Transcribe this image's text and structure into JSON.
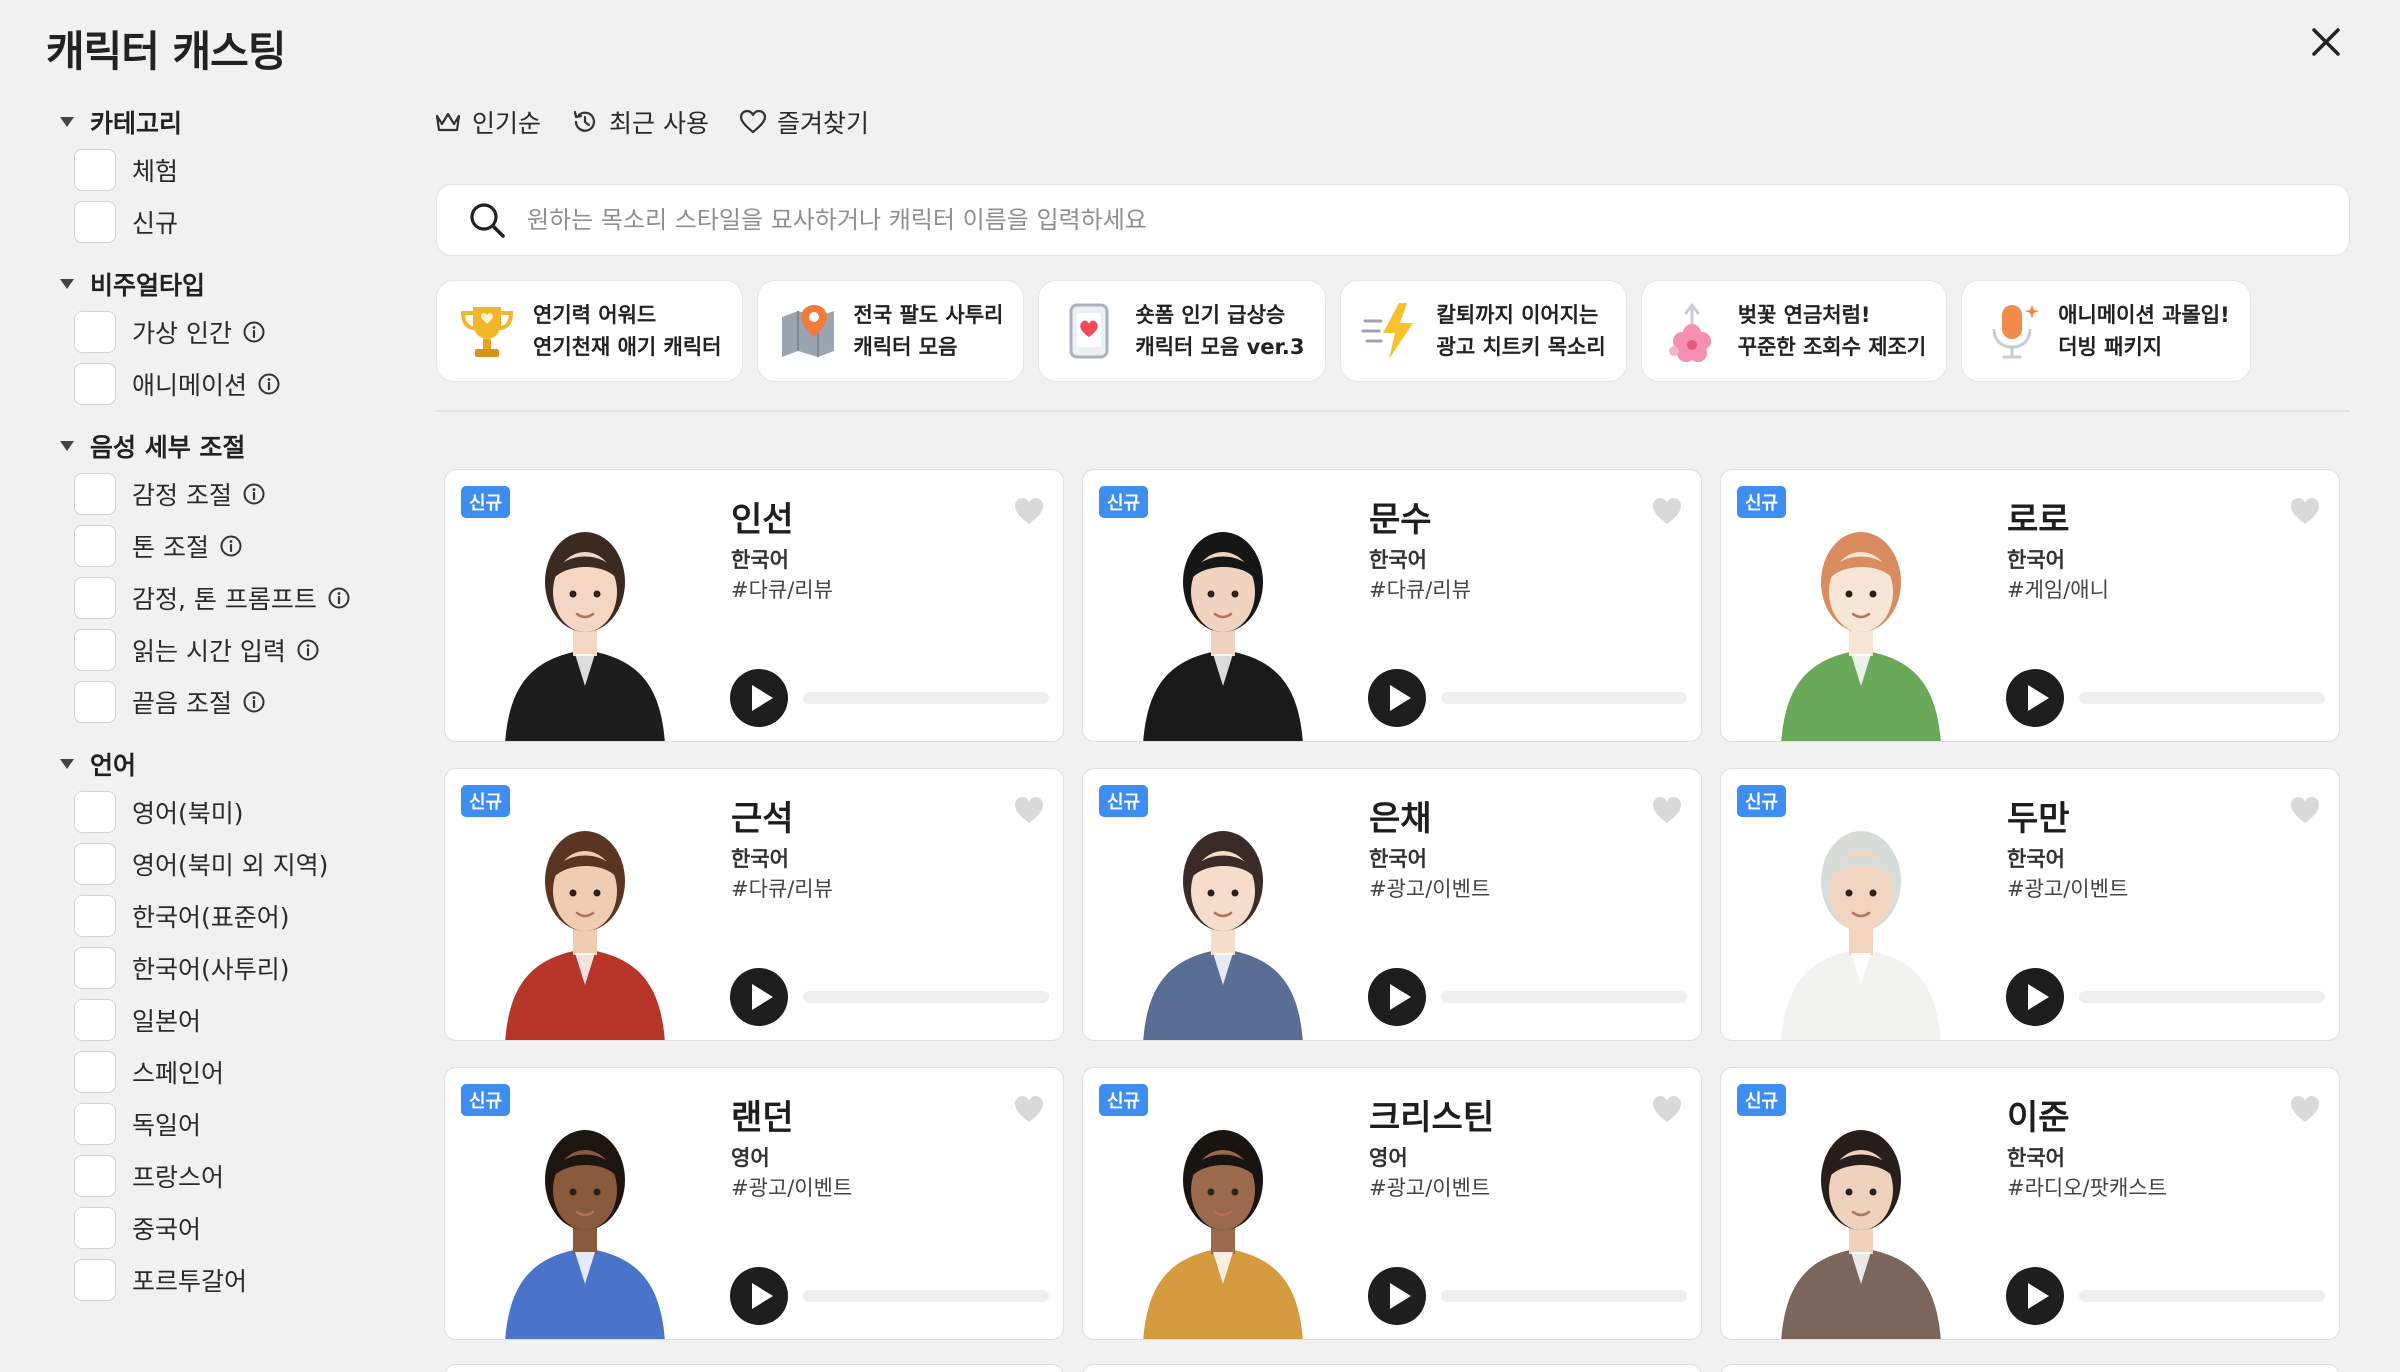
{
  "header": {
    "title": "캐릭터 캐스팅",
    "close_icon": "close-icon"
  },
  "sidebar": {
    "sections": [
      {
        "title": "카테고리",
        "options": [
          {
            "label": "체험",
            "info": false
          },
          {
            "label": "신규",
            "info": false
          }
        ]
      },
      {
        "title": "비주얼타입",
        "options": [
          {
            "label": "가상 인간",
            "info": true
          },
          {
            "label": "애니메이션",
            "info": true
          }
        ]
      },
      {
        "title": "음성 세부 조절",
        "options": [
          {
            "label": "감정 조절",
            "info": true
          },
          {
            "label": "톤 조절",
            "info": true
          },
          {
            "label": "감정, 톤 프롬프트",
            "info": true
          },
          {
            "label": "읽는 시간 입력",
            "info": true
          },
          {
            "label": "끝음 조절",
            "info": true
          }
        ]
      },
      {
        "title": "언어",
        "options": [
          {
            "label": "영어(북미)",
            "info": false
          },
          {
            "label": "영어(북미 외 지역)",
            "info": false
          },
          {
            "label": "한국어(표준어)",
            "info": false
          },
          {
            "label": "한국어(사투리)",
            "info": false
          },
          {
            "label": "일본어",
            "info": false
          },
          {
            "label": "스페인어",
            "info": false
          },
          {
            "label": "독일어",
            "info": false
          },
          {
            "label": "프랑스어",
            "info": false
          },
          {
            "label": "중국어",
            "info": false
          },
          {
            "label": "포르투갈어",
            "info": false
          }
        ]
      }
    ]
  },
  "sort_tabs": [
    {
      "label": "인기순",
      "icon": "crown-icon"
    },
    {
      "label": "최근 사용",
      "icon": "history-icon"
    },
    {
      "label": "즐겨찾기",
      "icon": "heart-outline-icon"
    }
  ],
  "search": {
    "placeholder": "원하는 목소리 스타일을 묘사하거나 캐릭터 이름을 입력하세요",
    "value": ""
  },
  "collections": [
    {
      "line1": "연기력 어워드",
      "line2": "연기천재 애기 캐릭터",
      "icon": "trophy-icon"
    },
    {
      "line1": "전국 팔도 사투리",
      "line2": "캐릭터 모음",
      "icon": "map-pin-icon"
    },
    {
      "line1": "숏폼 인기 급상승",
      "line2": "캐릭터 모음 ver.3",
      "icon": "phone-heart-icon"
    },
    {
      "line1": "칼퇴까지 이어지는",
      "line2": "광고 치트키 목소리",
      "icon": "lightning-icon"
    },
    {
      "line1": "벚꽃 연금처럼!",
      "line2": "꾸준한 조회수 제조기",
      "icon": "cherry-blossom-icon"
    },
    {
      "line1": "애니메이션 과몰입!",
      "line2": "더빙 패키지",
      "icon": "microphone-icon"
    }
  ],
  "badge_label": "신규",
  "characters": [
    {
      "name": "인선",
      "language": "한국어",
      "tag": "#다큐/리뷰",
      "portrait": "woman-business-suit-portrait",
      "colors": {
        "hair": "#3a2a22",
        "skin": "#f4d6c2",
        "top": "#1d1d1d",
        "bg": ""
      }
    },
    {
      "name": "문수",
      "language": "한국어",
      "tag": "#다큐/리뷰",
      "portrait": "man-suit-clipboard-portrait",
      "colors": {
        "hair": "#161616",
        "skin": "#f1d4c0",
        "top": "#1a1a1a",
        "bg": ""
      }
    },
    {
      "name": "로로",
      "language": "한국어",
      "tag": "#게임/애니",
      "portrait": "bunny-creature-portrait",
      "colors": {
        "hair": "#d98c5f",
        "skin": "#f7e6d6",
        "top": "#6aa85a",
        "bg": ""
      }
    },
    {
      "name": "근석",
      "language": "한국어",
      "tag": "#다큐/리뷰",
      "portrait": "young-man-red-jacket-portrait",
      "colors": {
        "hair": "#5a3522",
        "skin": "#f0cdb2",
        "top": "#b8352a",
        "bg": ""
      }
    },
    {
      "name": "은채",
      "language": "한국어",
      "tag": "#광고/이벤트",
      "portrait": "woman-microphone-portrait",
      "colors": {
        "hair": "#3a2b26",
        "skin": "#f5dccb",
        "top": "#5a6d94",
        "bg": ""
      }
    },
    {
      "name": "두만",
      "language": "한국어",
      "tag": "#광고/이벤트",
      "portrait": "old-man-glasses-portrait",
      "colors": {
        "hair": "#d8dcd8",
        "skin": "#f1d5c1",
        "top": "#f2f2f0",
        "bg": ""
      }
    },
    {
      "name": "랜던",
      "language": "영어",
      "tag": "#광고/이벤트",
      "portrait": "man-blue-shirt-portrait",
      "colors": {
        "hair": "#1e1410",
        "skin": "#8a5a3c",
        "top": "#4a74c9",
        "bg": ""
      }
    },
    {
      "name": "크리스틴",
      "language": "영어",
      "tag": "#광고/이벤트",
      "portrait": "woman-yellow-jacket-portrait",
      "colors": {
        "hair": "#1a1411",
        "skin": "#9b6a4c",
        "top": "#d69a3f",
        "bg": ""
      }
    },
    {
      "name": "이준",
      "language": "한국어",
      "tag": "#라디오/팟캐스트",
      "portrait": "man-brown-suit-portrait",
      "colors": {
        "hair": "#2a1e1a",
        "skin": "#efd2bd",
        "top": "#7a665c",
        "bg": ""
      }
    }
  ],
  "colors": {
    "accent": "#3d8ef0",
    "background": "#f1f1f1",
    "card": "#ffffff",
    "heart": "#d9d9d9",
    "play": "#1e1e1e"
  }
}
